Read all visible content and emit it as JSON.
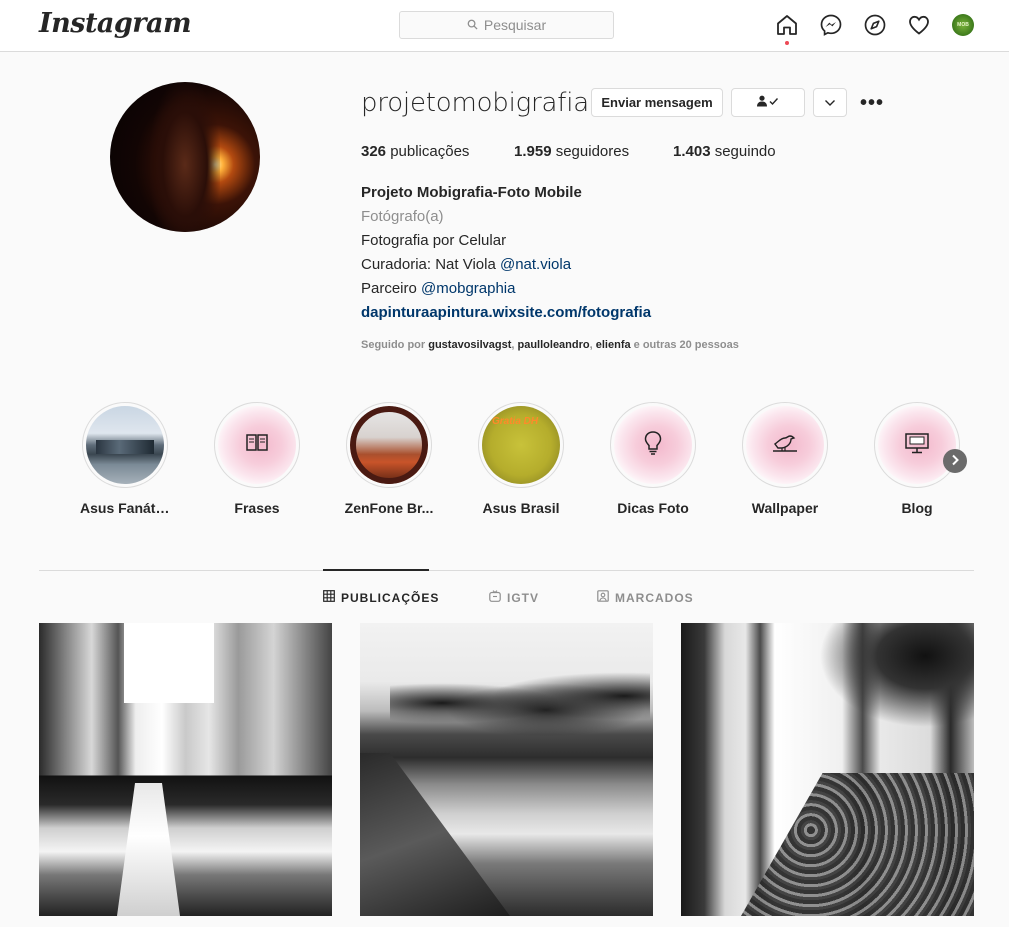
{
  "nav": {
    "logo": "Instagram",
    "search_placeholder": "Pesquisar",
    "avatar_text": "MOB"
  },
  "profile": {
    "username": "projetomobigrafia",
    "buttons": {
      "message": "Enviar mensagem",
      "more": "•••"
    },
    "stats": {
      "posts_num": "326",
      "posts_label": " publicações",
      "followers_num": "1.959",
      "followers_label": " seguidores",
      "following_num": "1.403",
      "following_label": " seguindo"
    },
    "bio": {
      "name": "Projeto Mobigrafia-Foto Mobile",
      "category": "Fotógrafo(a)",
      "line1": "Fotografia por Celular",
      "line2_prefix": "Curadoria: Nat Viola ",
      "line2_mention": "@nat.viola",
      "line3_prefix": "Parceiro ",
      "line3_mention": "@mobgraphia",
      "link": "dapinturaapintura.wixsite.com/fotografia"
    },
    "followed_by": {
      "prefix": "Seguido por ",
      "user1": "gustavosilvagst",
      "sep1": ", ",
      "user2": "paulloleandro",
      "sep2": ", ",
      "user3": "elienfa",
      "suffix": " e outras 20 pessoas"
    }
  },
  "highlights": [
    {
      "label": "Asus Fanáti...",
      "icon": "photo-thumbnail"
    },
    {
      "label": "Frases",
      "icon": "book-icon"
    },
    {
      "label": "ZenFone Br...",
      "icon": "photo-thumbnail"
    },
    {
      "label": "Asus Brasil",
      "icon": "photo-thumbnail"
    },
    {
      "label": "Dicas Foto",
      "icon": "lightbulb-icon"
    },
    {
      "label": "Wallpaper",
      "icon": "bird-icon"
    },
    {
      "label": "Blog",
      "icon": "monitor-icon"
    }
  ],
  "highlight_text": {
    "asus_brasil_banner": "Gratia DH"
  },
  "tabs": [
    {
      "label": "PUBLICAÇÕES",
      "icon": "grid-icon",
      "active": true
    },
    {
      "label": "IGTV",
      "icon": "igtv-icon",
      "active": false
    },
    {
      "label": "MARCADOS",
      "icon": "tagged-icon",
      "active": false
    }
  ],
  "colors": {
    "link": "#00376b",
    "notification_dot": "#ed4956",
    "border": "#dbdbdb",
    "secondary_text": "#8e8e8e"
  }
}
